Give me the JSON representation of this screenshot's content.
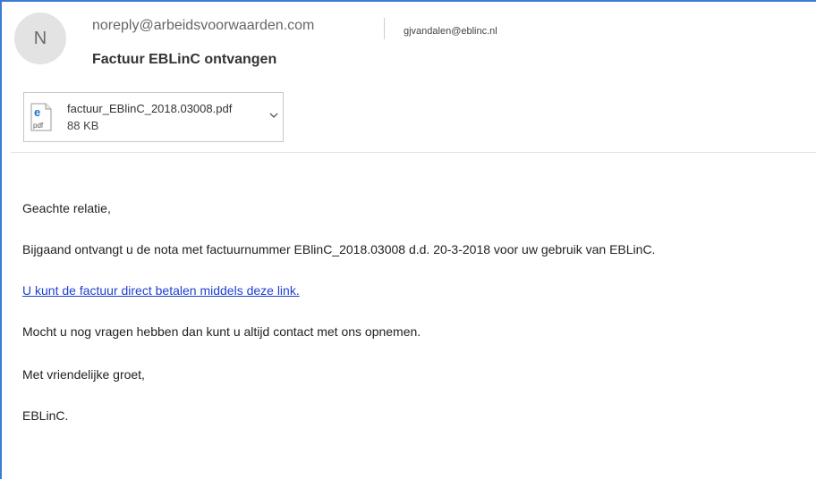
{
  "header": {
    "avatar_initial": "N",
    "from": "noreply@arbeidsvoorwaarden.com",
    "to": "gjvandalen@eblinc.nl",
    "subject": "Factuur EBLinC ontvangen"
  },
  "attachment": {
    "filename": "factuur_EBlinC_2018.03008.pdf",
    "size": "88 KB",
    "icon_label": "pdf"
  },
  "body": {
    "greeting": "Geachte relatie,",
    "line1": "Bijgaand ontvangt u de nota met factuurnummer EBlinC_2018.03008 d.d. 20-3-2018 voor uw gebruik van EBLinC.",
    "link_text": "U kunt de factuur direct betalen middels deze link.",
    "line3": "Mocht u nog vragen hebben dan kunt u altijd contact met ons opnemen.",
    "closing": "Met vriendelijke groet,",
    "signature": "EBLinC."
  },
  "colors": {
    "accent": "#3b7bd4",
    "link": "#2040d0"
  }
}
